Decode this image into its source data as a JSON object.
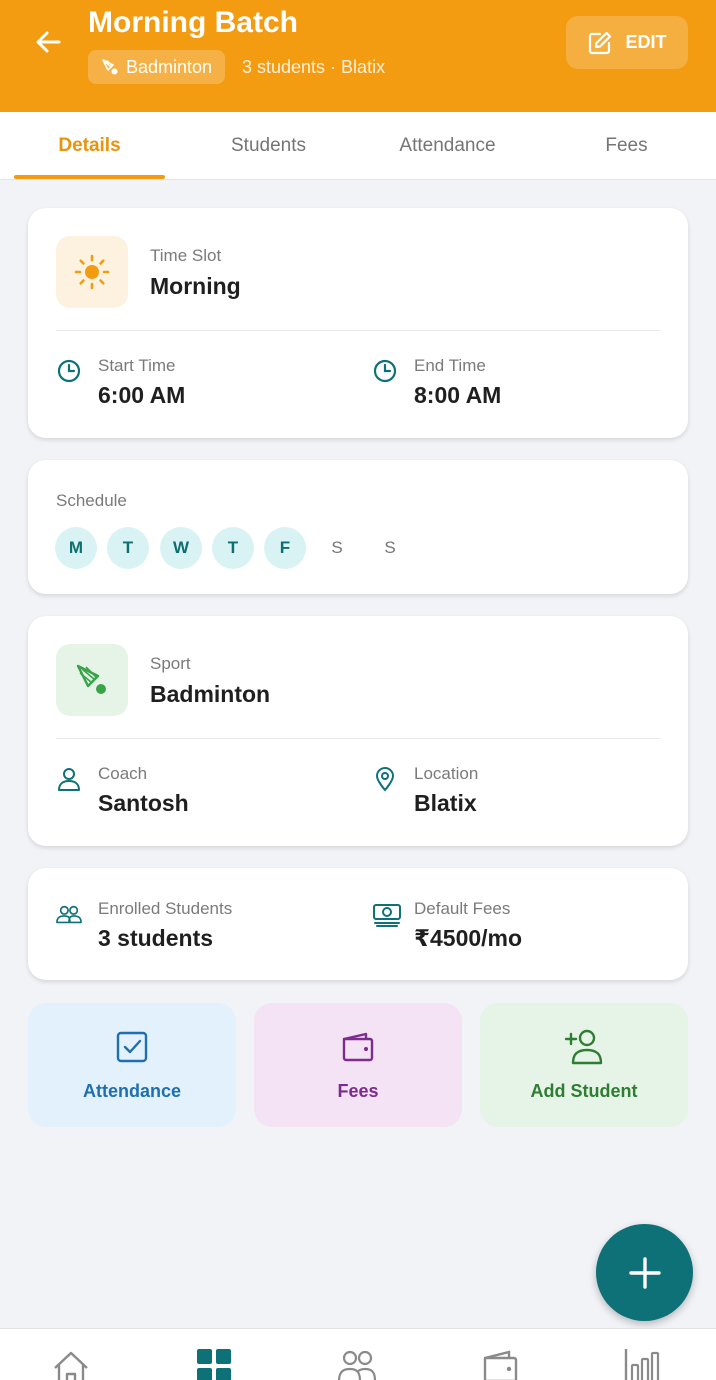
{
  "header": {
    "title": "Morning Batch",
    "sport_chip": "Badminton",
    "subtitle": "3 students · Blatix",
    "edit_label": "EDIT"
  },
  "tabs": [
    {
      "label": "Details",
      "active": true
    },
    {
      "label": "Students",
      "active": false
    },
    {
      "label": "Attendance",
      "active": false
    },
    {
      "label": "Fees",
      "active": false
    }
  ],
  "time_card": {
    "slot_label": "Time Slot",
    "slot_value": "Morning",
    "start_label": "Start Time",
    "start_value": "6:00 AM",
    "end_label": "End Time",
    "end_value": "8:00 AM"
  },
  "schedule": {
    "label": "Schedule",
    "days": [
      {
        "letter": "M",
        "active": true
      },
      {
        "letter": "T",
        "active": true
      },
      {
        "letter": "W",
        "active": true
      },
      {
        "letter": "T",
        "active": true
      },
      {
        "letter": "F",
        "active": true
      },
      {
        "letter": "S",
        "active": false
      },
      {
        "letter": "S",
        "active": false
      }
    ]
  },
  "sport_card": {
    "sport_label": "Sport",
    "sport_value": "Badminton",
    "coach_label": "Coach",
    "coach_value": "Santosh",
    "location_label": "Location",
    "location_value": "Blatix"
  },
  "stats_card": {
    "enrolled_label": "Enrolled Students",
    "enrolled_value": "3 students",
    "fees_label": "Default Fees",
    "fees_value": "₹4500/mo"
  },
  "actions": [
    {
      "label": "Attendance",
      "icon": "checkbox-icon"
    },
    {
      "label": "Fees",
      "icon": "wallet-icon"
    },
    {
      "label": "Add Student",
      "icon": "add-person-icon"
    }
  ],
  "bottom_nav": [
    {
      "icon": "home-icon",
      "active": false
    },
    {
      "icon": "grid-icon",
      "active": true
    },
    {
      "icon": "people-icon",
      "active": false
    },
    {
      "icon": "wallet-icon",
      "active": false
    },
    {
      "icon": "bar-chart-icon",
      "active": false
    }
  ],
  "colors": {
    "header": "#f39c12",
    "accent_teal": "#0e7177",
    "tab_active": "#e8940c",
    "attendance_tile": "#e3f1fc",
    "fees_tile": "#f3e3f5",
    "add_student_tile": "#e6f4e8"
  }
}
